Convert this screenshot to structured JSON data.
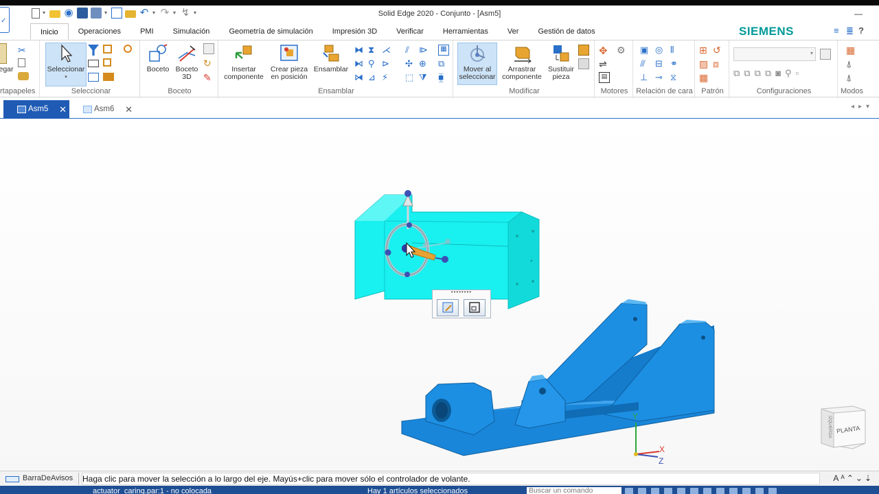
{
  "window": {
    "title": "Solid Edge 2020 - Conjunto - [Asm5]",
    "brand": "SIEMENS"
  },
  "ribbon_tabs": [
    "Inicio",
    "Operaciones",
    "PMI",
    "Simulación",
    "Geometría de simulación",
    "Impresión 3D",
    "Verificar",
    "Herramientas",
    "Ver",
    "Gestión de datos"
  ],
  "ribbon": {
    "portapapeles": {
      "paste": "egar",
      "label": "rtapapeles"
    },
    "seleccionar": {
      "button": "Seleccionar",
      "label": "Seleccionar"
    },
    "boceto": {
      "boceto": "Boceto",
      "boceto3d_1": "Boceto",
      "boceto3d_2": "3D",
      "label": "Boceto"
    },
    "ensamblar": {
      "insert_1": "Insertar",
      "insert_2": "componente",
      "create_1": "Crear pieza",
      "create_2": "en posición",
      "assemble": "Ensamblar",
      "label": "Ensamblar"
    },
    "modificar": {
      "move_1": "Mover al",
      "move_2": "seleccionar",
      "drag_1": "Arrastrar",
      "drag_2": "componente",
      "replace_1": "Sustituir",
      "replace_2": "pieza",
      "label": "Modificar"
    },
    "motores": {
      "label": "Motores"
    },
    "relacion": {
      "label": "Relación de cara"
    },
    "patron": {
      "label": "Patrón"
    },
    "configuraciones": {
      "label": "Configuraciones"
    },
    "modos": {
      "label": "Modos"
    }
  },
  "doc_tabs": [
    {
      "label": "Asm5",
      "active": true,
      "close": "✕"
    },
    {
      "label": "Asm6",
      "active": false,
      "close": "✕"
    }
  ],
  "viewport": {
    "viewcube_face": "PLANTA",
    "viewcube_side": "IZQUIERDA",
    "triad": {
      "x": "X",
      "y": "Y",
      "z": "Z"
    },
    "colors": {
      "selected_part": "#19f0f0",
      "base_part": "#1a86d9"
    }
  },
  "prompt_bar": {
    "label": "BarraDeAvisos",
    "message": "Haga clic para mover la selección a lo largo del eje. Mayús+clic para mover sólo el controlador de volante."
  },
  "status_bar": {
    "left": "actuator_caring.par:1 - no colocada",
    "center": "Hay 1 artículos seleccionados",
    "search_placeholder": "Buscar un comando"
  }
}
